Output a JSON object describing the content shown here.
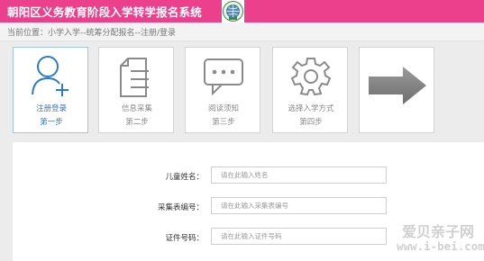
{
  "header": {
    "title": "朝阳区义务教育阶段入学转学报名系统",
    "logo_icon": "school-emblem-icon",
    "background": "#ec3f8c"
  },
  "breadcrumb": {
    "text": "当前位置：小学入学--统筹分配报名--注册/登录"
  },
  "steps": [
    {
      "title": "注册登录",
      "sub": "第一步",
      "icon": "user-add-icon",
      "active": true
    },
    {
      "title": "信息采集",
      "sub": "第二步",
      "icon": "document-icon",
      "active": false
    },
    {
      "title": "阅读须知",
      "sub": "第三步",
      "icon": "message-icon",
      "active": false
    },
    {
      "title": "选择入学方式",
      "sub": "第四步",
      "icon": "gear-icon",
      "active": false
    },
    {
      "title": "",
      "sub": "",
      "icon": "arrow-right-icon",
      "active": false
    }
  ],
  "form": {
    "fields": [
      {
        "label": "儿童姓名：",
        "placeholder": "请在此输入姓名"
      },
      {
        "label": "采集表编号：",
        "placeholder": "请在此输入采集表编号"
      },
      {
        "label": "证件号码：",
        "placeholder": "请在此输入证件号码"
      }
    ]
  },
  "watermark": {
    "text": "爱贝亲子网",
    "url": "www.i-bei.com"
  },
  "colors": {
    "accent_blue": "#2b7cc4",
    "active_border": "#9fc4e6",
    "inactive_text": "#888888",
    "brand_pink": "#ec3f8c"
  }
}
